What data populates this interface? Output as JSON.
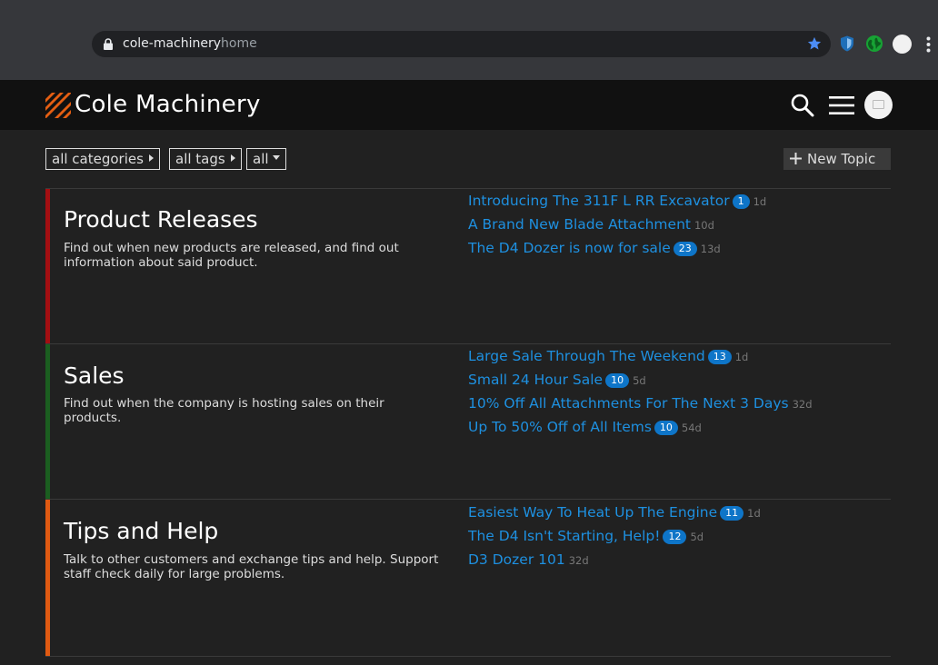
{
  "browser": {
    "url_host": "cole-machinery",
    "url_path": "home"
  },
  "site": {
    "title": "Cole Machinery",
    "accent_color": "#e45e12"
  },
  "filters": {
    "categories_label": "all categories",
    "tags_label": "all tags",
    "all_label": "all",
    "new_topic_label": "New Topic"
  },
  "categories": [
    {
      "name": "Product Releases",
      "description": "Find out when new products are released, and find out information about said product.",
      "color": "#a30f12",
      "topics": [
        {
          "title": "Introducing The 311F L RR Excavator",
          "badge": "1",
          "age": "1d"
        },
        {
          "title": "A Brand New Blade Attachment",
          "badge": "",
          "age": "10d"
        },
        {
          "title": "The D4 Dozer is now for sale",
          "badge": "23",
          "age": "13d"
        }
      ]
    },
    {
      "name": "Sales",
      "description": "Find out when the company is hosting sales on their products.",
      "color": "#1b5e20",
      "topics": [
        {
          "title": "Large Sale Through The Weekend",
          "badge": "13",
          "age": "1d"
        },
        {
          "title": "Small 24 Hour Sale",
          "badge": "10",
          "age": "5d"
        },
        {
          "title": "10% Off All Attachments For The Next 3 Days",
          "badge": "",
          "age": "32d"
        },
        {
          "title": "Up To 50% Off of All Items",
          "badge": "10",
          "age": "54d"
        }
      ]
    },
    {
      "name": "Tips and Help",
      "description": "Talk to other customers and exchange tips and help. Support staff check daily for large problems.",
      "color": "#e05a12",
      "topics": [
        {
          "title": "Easiest Way To Heat Up The Engine",
          "badge": "11",
          "age": "1d"
        },
        {
          "title": "The D4 Isn't Starting, Help!",
          "badge": "12",
          "age": "5d"
        },
        {
          "title": "D3 Dozer 101",
          "badge": "",
          "age": "32d"
        }
      ]
    }
  ]
}
